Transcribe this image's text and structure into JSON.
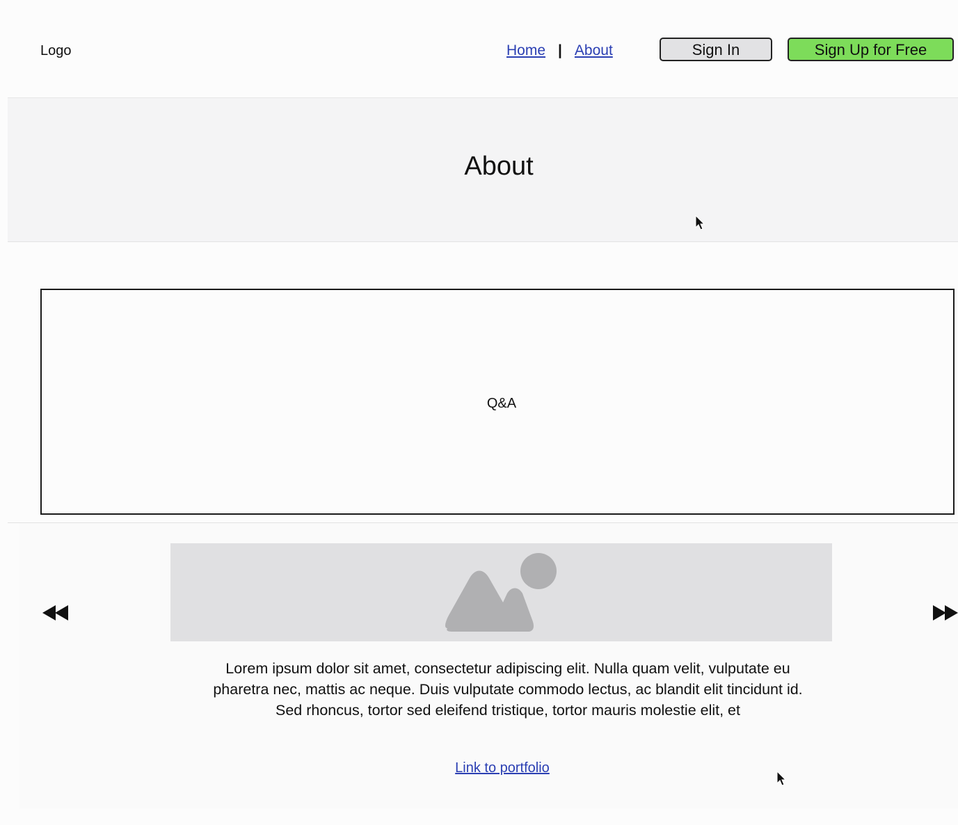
{
  "header": {
    "logo": "Logo",
    "nav": {
      "home": "Home",
      "separator": "|",
      "about": "About"
    },
    "sign_in": "Sign In",
    "sign_up": "Sign Up for Free"
  },
  "hero": {
    "title": "About"
  },
  "qa": {
    "label": "Q&A"
  },
  "carousel": {
    "prev_icon": "rewind-icon",
    "next_icon": "fast-forward-icon",
    "image_icon": "image-placeholder-icon",
    "description": "Lorem ipsum dolor sit amet, consectetur adipiscing elit. Nulla quam velit, vulputate eu pharetra nec, mattis ac neque. Duis vulputate commodo lectus, ac blandit elit tincidunt id. Sed rhoncus, tortor sed eleifend tristique, tortor mauris molestie elit, et",
    "link": "Link to portfolio"
  },
  "colors": {
    "link": "#2b3fb3",
    "sign_up_bg": "#7ddc5a",
    "sign_in_bg": "#e2e2e4",
    "placeholder_bg": "#e0e0e2",
    "placeholder_shape": "#b0b0b2"
  }
}
